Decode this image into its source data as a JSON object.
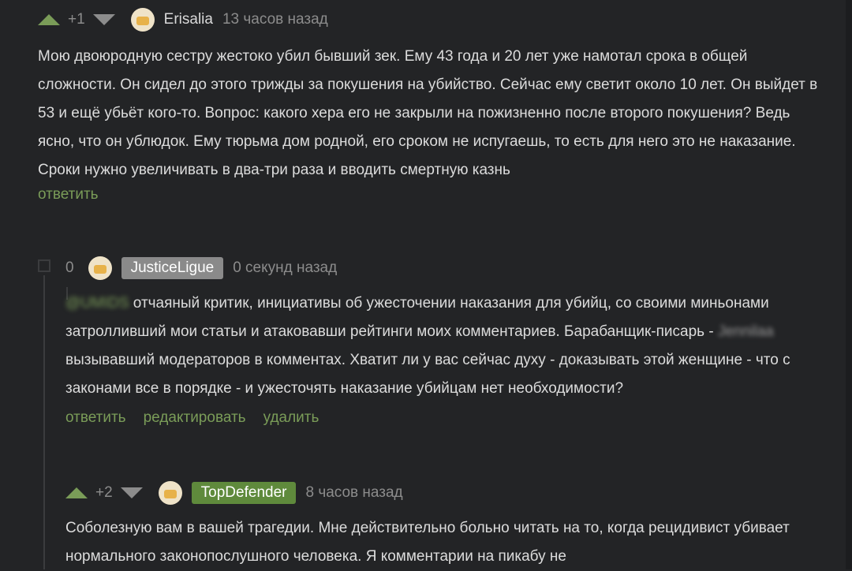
{
  "comments": [
    {
      "rating": "+1",
      "author": "Erisalia",
      "time": "13 часов назад",
      "text": "Мою двоюродную сестру жестоко убил бывший зек. Ему 43 года и 20 лет уже намотал срока в общей сложности. Он сидел до этого трижды за покушения на убийство. Сейчас ему светит около 10 лет. Он выйдет в 53 и ещё убьёт кого-то. Вопрос: какого хера его не закрыли на пожизненно после второго покушения? Ведь ясно, что он ублюдок. Ему тюрьма дом родной, его сроком не испугаешь, то есть для него это не наказание. Сроки нужно увеличивать в два-три раза и вводить смертную казнь",
      "reply_label": "ответить"
    },
    {
      "rating": "0",
      "author": "JusticeLigue",
      "author_color": "#8a8a8a",
      "time": "0 секунд назад",
      "mention1": "@UMIDS",
      "text_part1": " отчаяный критик, инициативы об ужесточении наказания для убийц,  со своими миньонами затролливший мои статьи и атаковавши рейтинги моих комментариев. Барабанщик-писарь - ",
      "mention2": "Jennilaa",
      "text_part2": " вызывавший модераторов в комментах. Хватит ли у вас сейчас духу - доказывать этой женщине - что с законами все в порядке - и ужесточять наказание убийцам нет необходимости?",
      "reply_label": "ответить",
      "edit_label": "редактировать",
      "delete_label": "удалить"
    },
    {
      "rating": "+2",
      "author": "TopDefender",
      "author_color": "#5f8a3c",
      "time": "8 часов назад",
      "text": "Соболезную вам в вашей трагедии. Мне действительно больно читать на то, когда рецидивист убивает нормального законопослушного человека. Я комментарии на пикабу не"
    }
  ],
  "colors": {
    "background": "#232426",
    "accent_green": "#7a9c58",
    "muted": "#8c8c8c"
  }
}
